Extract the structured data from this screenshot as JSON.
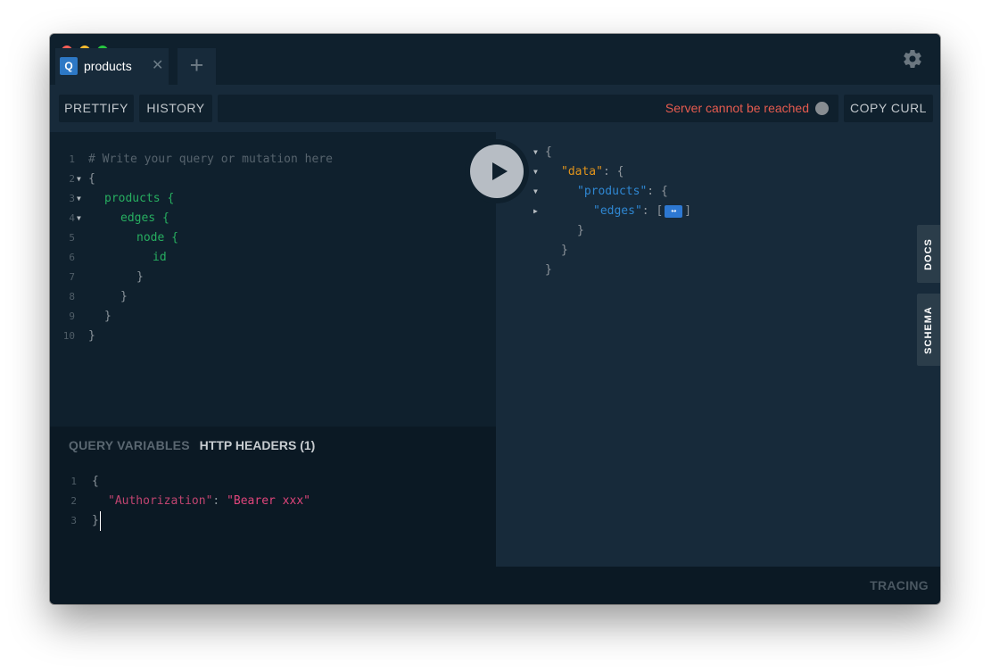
{
  "tab": {
    "badge": "Q",
    "title": "products",
    "close": "✕",
    "add": "+"
  },
  "toolbar": {
    "prettify": "PRETTIFY",
    "history": "HISTORY",
    "status": "Server cannot be reached",
    "copy_curl": "COPY CURL"
  },
  "editor": {
    "lines": [
      {
        "n": "1",
        "text": "# Write your query or mutation here"
      },
      {
        "n": "2",
        "text": "{"
      },
      {
        "n": "3",
        "text": "products {"
      },
      {
        "n": "4",
        "text": "edges {"
      },
      {
        "n": "5",
        "text": "node {"
      },
      {
        "n": "6",
        "text": "id"
      },
      {
        "n": "7",
        "text": "}"
      },
      {
        "n": "8",
        "text": "}"
      },
      {
        "n": "9",
        "text": "}"
      },
      {
        "n": "10",
        "text": "}"
      }
    ]
  },
  "variables": {
    "tabs": [
      "QUERY VARIABLES",
      "HTTP HEADERS (1)"
    ],
    "lines": [
      {
        "n": "1",
        "text": "{"
      },
      {
        "n": "2",
        "key": "\"Authorization\"",
        "sep": ": ",
        "value": "\"Bearer xxx\""
      },
      {
        "n": "3",
        "text": "}"
      }
    ]
  },
  "result": {
    "l1": "{",
    "data_key": "\"data\"",
    "colon": ": ",
    "brace": "{",
    "products_key": "\"products\"",
    "edges_key": "\"edges\"",
    "edges_open": "[",
    "collapsed": "↔",
    "edges_close": "]",
    "close": "}"
  },
  "side_tabs": {
    "docs": "DOCS",
    "schema": "SCHEMA"
  },
  "footer": {
    "tracing": "TRACING"
  },
  "colors": {
    "accent": "#2d78c5",
    "error": "#e65b4f",
    "field": "#27ae60",
    "result_key": "#2f87d2",
    "data_key": "#e2941b"
  }
}
